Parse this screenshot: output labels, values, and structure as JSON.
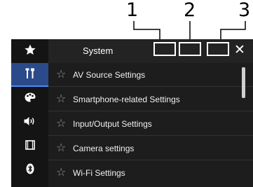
{
  "callouts": [
    "1",
    "2",
    "3"
  ],
  "header": {
    "title": "System",
    "close_icon": "close-icon"
  },
  "sidebar": {
    "items": [
      {
        "name": "favorite",
        "icon": "star-icon"
      },
      {
        "name": "system",
        "icon": "tools-icon",
        "active": true
      },
      {
        "name": "theme",
        "icon": "palette-icon"
      },
      {
        "name": "audio",
        "icon": "speaker-icon"
      },
      {
        "name": "video",
        "icon": "film-icon"
      },
      {
        "name": "bluetooth",
        "icon": "bluetooth-icon"
      }
    ]
  },
  "list": {
    "items": [
      {
        "label": "AV Source Settings"
      },
      {
        "label": "Smartphone-related Settings"
      },
      {
        "label": "Input/Output Settings"
      },
      {
        "label": "Camera settings"
      },
      {
        "label": "Wi-Fi Settings"
      }
    ]
  },
  "colors": {
    "screen_bg": "#1d1d1d",
    "sidebar_bg": "#141414",
    "active_bg": "#2a4a8a",
    "text": "#ffffff",
    "star": "#9a9a9a"
  }
}
